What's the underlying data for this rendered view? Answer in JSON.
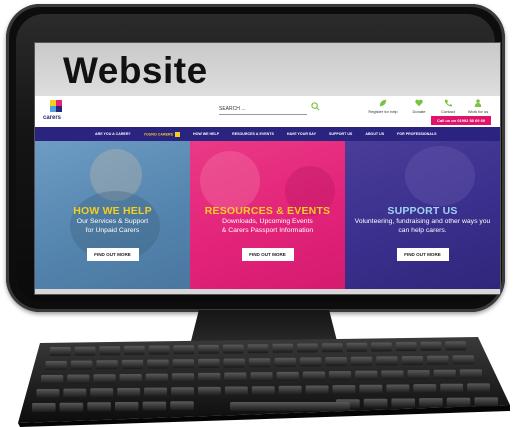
{
  "slide": {
    "title": "Website"
  },
  "site": {
    "logo_text": "carers",
    "search_placeholder": "SEARCH ...",
    "header_links": [
      {
        "label": "Register for help",
        "icon": "leaf-icon",
        "color": "#7bc142"
      },
      {
        "label": "Donate",
        "icon": "heart-icon",
        "color": "#7bc142"
      },
      {
        "label": "Contact",
        "icon": "phone-icon",
        "color": "#7bc142"
      },
      {
        "label": "Work for us",
        "icon": "person-icon",
        "color": "#7bc142"
      }
    ],
    "call_label": "Call us on 01992 58 69 69",
    "nav": [
      "ARE YOU A CARER?",
      "YOUNG CARERS",
      "HOW WE HELP",
      "RESOURCES & EVENTS",
      "HAVE YOUR SAY",
      "SUPPORT US",
      "ABOUT US",
      "FOR PROFESSIONALS"
    ],
    "panels": [
      {
        "title": "HOW WE HELP",
        "desc_1": "Our Services & Support",
        "desc_2": "for Unpaid Carers",
        "button": "FIND OUT MORE",
        "title_color": "#f4cf1f",
        "bg_color": "#5f8fb8"
      },
      {
        "title": "RESOURCES & EVENTS",
        "desc_1": "Downloads, Upcoming Events",
        "desc_2": "& Carers Passport Information",
        "button": "FIND OUT MORE",
        "title_color": "#f4cf1f",
        "bg_color": "#e3237a"
      },
      {
        "title": "SUPPORT US",
        "desc_1": "Volunteering, fundraising and other ways you",
        "desc_2": "can help carers.",
        "button": "FIND OUT MORE",
        "title_color": "#9fd3f2",
        "bg_color": "#3a2f8c"
      }
    ],
    "brand_color": "#2a2480",
    "accent_color": "#e0146b"
  }
}
